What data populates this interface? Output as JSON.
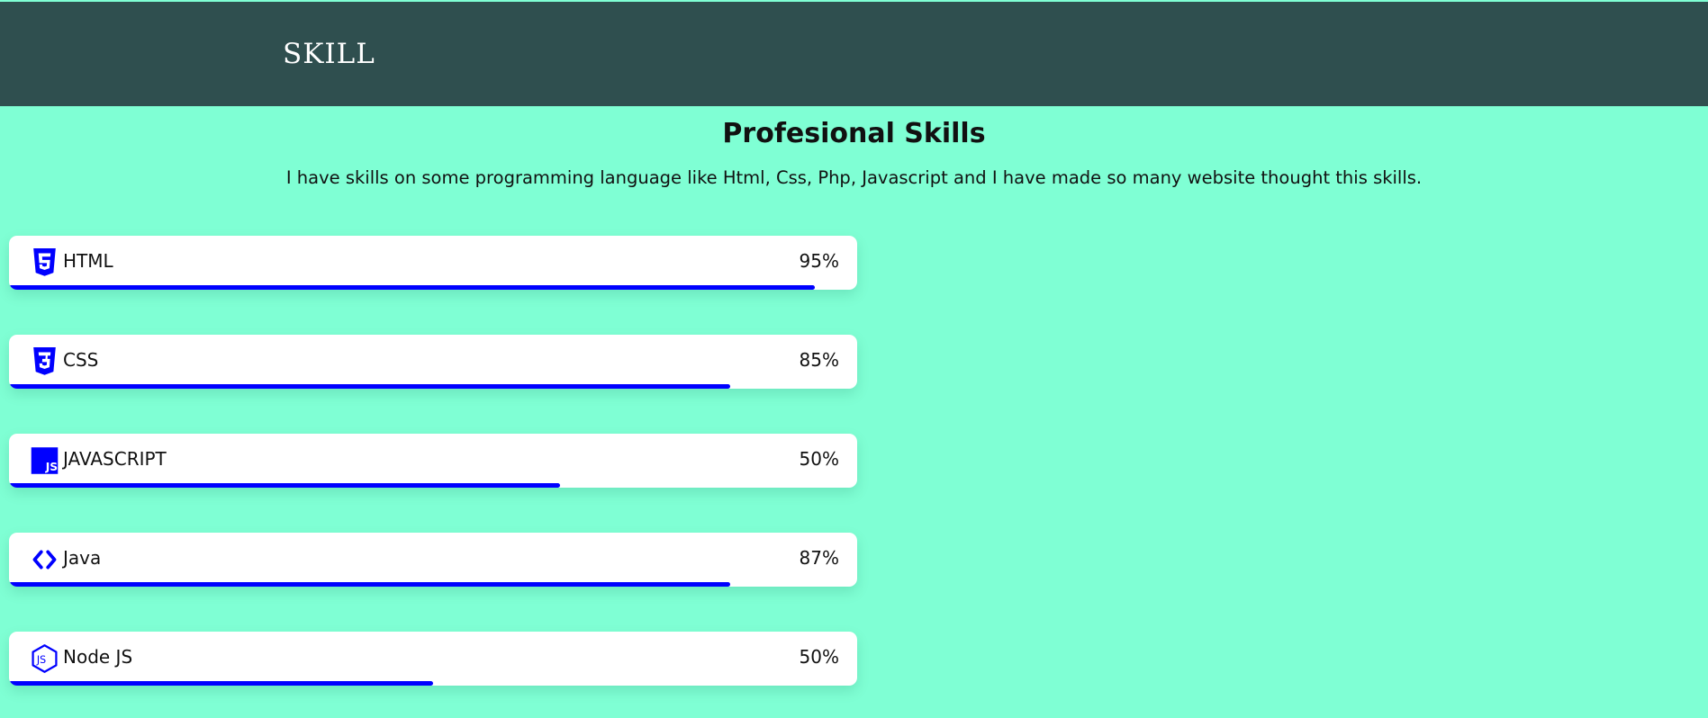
{
  "header": {
    "brand": "SKILL"
  },
  "section": {
    "title": "Profesional Skills",
    "description": "I have skills on some programming language like Html, Css, Php, Javascript and I have made so many website thought this skills."
  },
  "colors": {
    "background": "#7fffd4",
    "header": "#2f4f4f",
    "accent": "#0000ff"
  },
  "skills": [
    {
      "name": "HTML",
      "percent_label": "95%",
      "bar_fraction": 0.95,
      "icon": "html5-icon"
    },
    {
      "name": "CSS",
      "percent_label": "85%",
      "bar_fraction": 0.85,
      "icon": "css3-icon"
    },
    {
      "name": "JAVASCRIPT",
      "percent_label": "50%",
      "bar_fraction": 0.65,
      "icon": "javascript-icon"
    },
    {
      "name": "Java",
      "percent_label": "87%",
      "bar_fraction": 0.85,
      "icon": "code-brackets-icon"
    },
    {
      "name": "Node JS",
      "percent_label": "50%",
      "bar_fraction": 0.5,
      "icon": "nodejs-icon"
    }
  ]
}
